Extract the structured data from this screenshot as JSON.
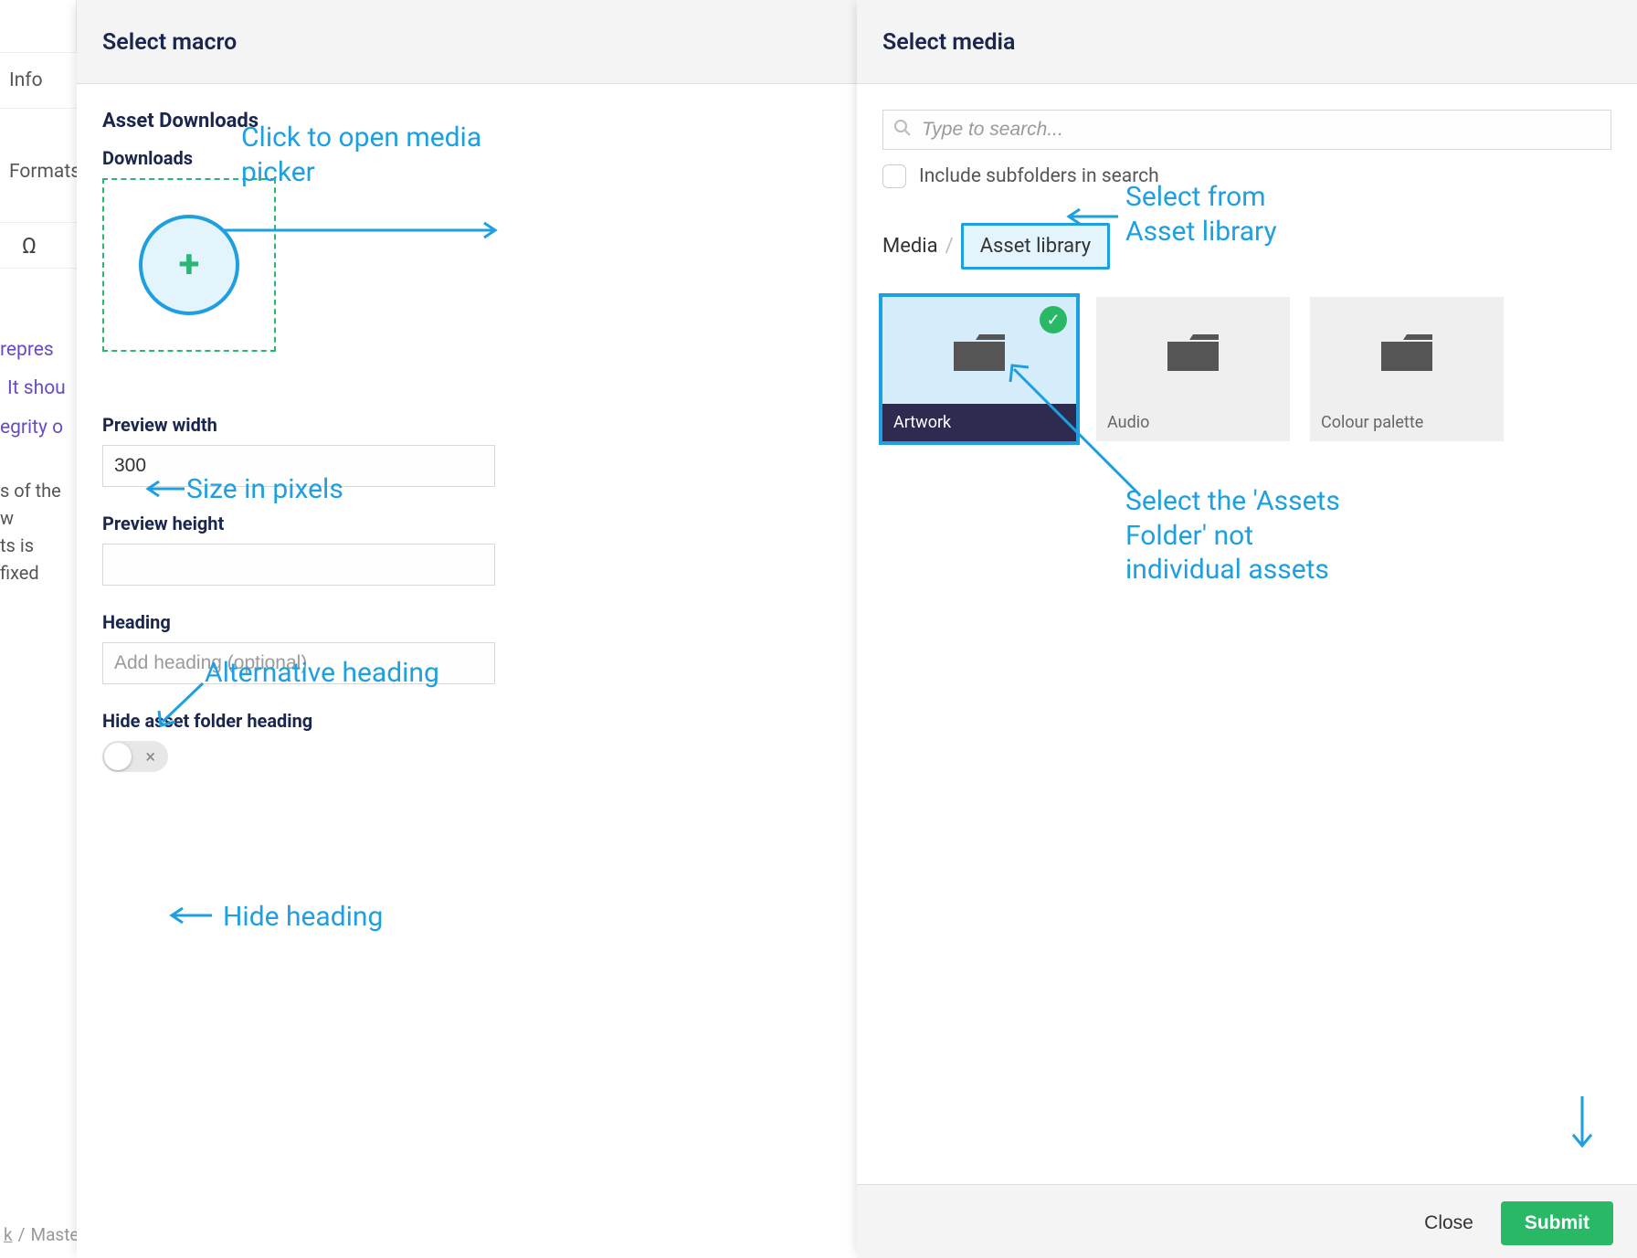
{
  "bg": {
    "tabs": [
      "Info",
      "Formats"
    ],
    "omega": "Ω",
    "purple_lines": [
      "repres",
      "It shou",
      "egrity o"
    ],
    "gray_lines": [
      "s of the w",
      "ts is fixed"
    ],
    "crumb_sep": "/",
    "crumb_k": "k",
    "crumb_master": "Master"
  },
  "left_panel": {
    "title": "Select macro",
    "section": "Asset Downloads",
    "downloads_label": "Downloads",
    "preview_width_label": "Preview width",
    "preview_width_value": "300",
    "preview_height_label": "Preview height",
    "preview_height_value": "",
    "heading_label": "Heading",
    "heading_placeholder": "Add heading (optional)",
    "hide_label": "Hide asset folder heading"
  },
  "right_panel": {
    "title": "Select media",
    "search_placeholder": "Type to search...",
    "include_sub": "Include subfolders in search",
    "crumb_media": "Media",
    "crumb_lib": "Asset library",
    "tiles": {
      "artwork": "Artwork",
      "audio": "Audio",
      "colour": "Colour palette"
    },
    "close": "Close",
    "submit": "Submit"
  },
  "annotations": {
    "open_picker": "Click to open media picker",
    "size_px": "Size in pixels",
    "alt_heading": "Alternative heading",
    "hide_heading": "Hide heading",
    "select_lib": "Select from Asset library",
    "select_folder": "Select the 'Assets Folder' not individual assets"
  }
}
